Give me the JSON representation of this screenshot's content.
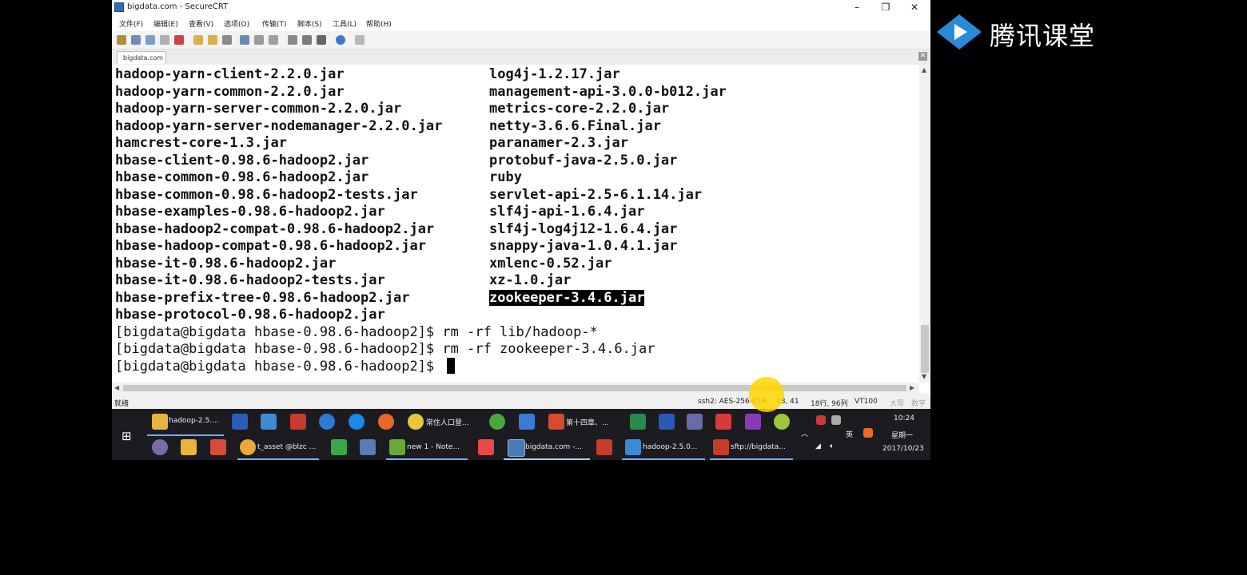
{
  "window": {
    "title": "bigdata.com - SecureCRT",
    "menu": [
      "文件(F)",
      "编辑(E)",
      "查看(V)",
      "选项(O)",
      "传输(T)",
      "脚本(S)",
      "工具(L)",
      "帮助(H)"
    ],
    "tab_label": "bigdata.com",
    "minimize": "–",
    "maximize": "❐",
    "close": "✕"
  },
  "terminal": {
    "left_column": [
      "hadoop-yarn-client-2.2.0.jar",
      "hadoop-yarn-common-2.2.0.jar",
      "hadoop-yarn-server-common-2.2.0.jar",
      "hadoop-yarn-server-nodemanager-2.2.0.jar",
      "hamcrest-core-1.3.jar",
      "hbase-client-0.98.6-hadoop2.jar",
      "hbase-common-0.98.6-hadoop2.jar",
      "hbase-common-0.98.6-hadoop2-tests.jar",
      "hbase-examples-0.98.6-hadoop2.jar",
      "hbase-hadoop2-compat-0.98.6-hadoop2.jar",
      "hbase-hadoop-compat-0.98.6-hadoop2.jar",
      "hbase-it-0.98.6-hadoop2.jar",
      "hbase-it-0.98.6-hadoop2-tests.jar",
      "hbase-prefix-tree-0.98.6-hadoop2.jar",
      "hbase-protocol-0.98.6-hadoop2.jar"
    ],
    "right_column": [
      "log4j-1.2.17.jar",
      "management-api-3.0.0-b012.jar",
      "metrics-core-2.2.0.jar",
      "netty-3.6.6.Final.jar",
      "paranamer-2.3.jar",
      "protobuf-java-2.5.0.jar",
      "ruby",
      "servlet-api-2.5-6.1.14.jar",
      "slf4j-api-1.6.4.jar",
      "slf4j-log4j12-1.6.4.jar",
      "snappy-java-1.0.4.1.jar",
      "xmlenc-0.52.jar",
      "xz-1.0.jar",
      "zookeeper-3.4.6.jar"
    ],
    "commands": [
      "[bigdata@bigdata hbase-0.98.6-hadoop2]$ rm -rf lib/hadoop-*",
      "[bigdata@bigdata hbase-0.98.6-hadoop2]$ rm -rf zookeeper-3.4.6.jar",
      "[bigdata@bigdata hbase-0.98.6-hadoop2]$ "
    ]
  },
  "statusbar": {
    "ready": "就绪",
    "ssh": "ssh2: AES-256-CTR",
    "pos": "18, 41",
    "size": "18行, 96列",
    "term": "VT100",
    "caps": "大写",
    "num": "数字"
  },
  "taskbar": {
    "row1": [
      "hadoop-2.5....",
      "常住人口登...",
      "第十四章、..."
    ],
    "row2": [
      "t_asset @blzc ...",
      "new 1 - Note...",
      "bigdata.com -...",
      "hadoop-2.5.0...",
      "sftp://bigdata..."
    ],
    "time": "10:24",
    "weekday": "星期一",
    "date": "2017/10/23",
    "ime": "英"
  },
  "brand": {
    "name": "腾讯课堂"
  }
}
